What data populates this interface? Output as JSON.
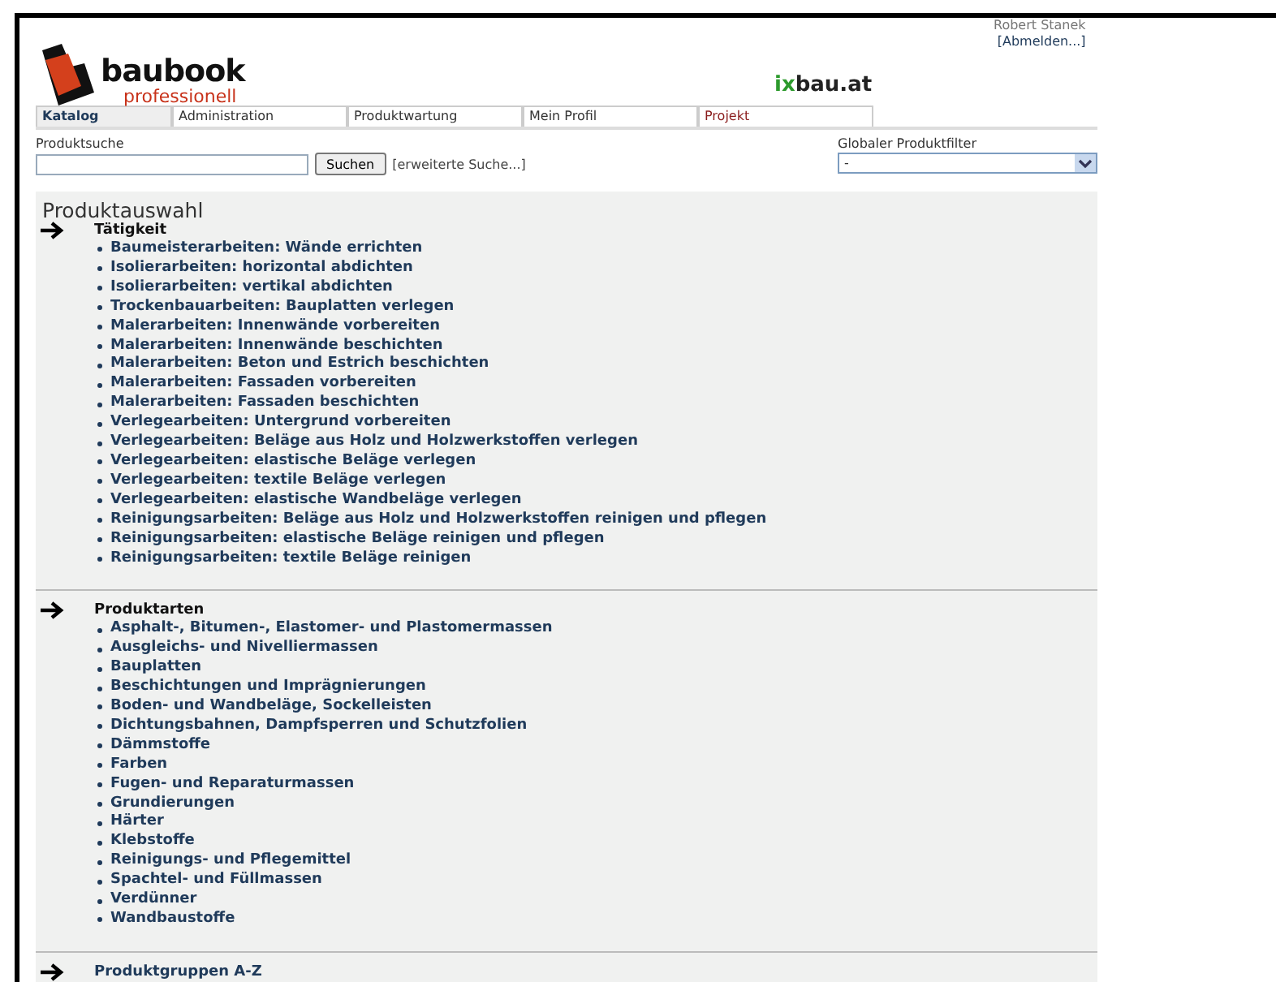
{
  "user": {
    "name": "Robert Stanek",
    "logout": "[Abmelden...]"
  },
  "brand": {
    "name": "baubook",
    "subtitle": "professionell"
  },
  "partner": {
    "prefix": "ix",
    "rest": "bau.at"
  },
  "tabs": [
    {
      "label": "Katalog",
      "selected": true,
      "color": "#1f3a5a"
    },
    {
      "label": "Administration",
      "selected": false,
      "color": "#333333"
    },
    {
      "label": "Produktwartung",
      "selected": false,
      "color": "#333333"
    },
    {
      "label": "Mein Profil",
      "selected": false,
      "color": "#333333"
    },
    {
      "label": "Projekt",
      "selected": false,
      "color": "#8b1e1e"
    }
  ],
  "search": {
    "label": "Produktsuche",
    "button": "Suchen",
    "advanced": "[erweiterte Suche...]"
  },
  "filter": {
    "label": "Globaler Produktfilter",
    "value": "-"
  },
  "panel": {
    "title": "Produktauswahl",
    "sections": [
      {
        "heading": "Tätigkeit",
        "expanded": true,
        "items": [
          "Baumeisterarbeiten: Wände errichten",
          "Isolierarbeiten: horizontal abdichten",
          "Isolierarbeiten: vertikal abdichten",
          "Trockenbauarbeiten: Bauplatten verlegen",
          "Malerarbeiten: Innenwände vorbereiten",
          "Malerarbeiten: Innenwände beschichten",
          "Malerarbeiten: Beton und Estrich beschichten",
          "Malerarbeiten: Fassaden vorbereiten",
          "Malerarbeiten: Fassaden beschichten",
          "Verlegearbeiten: Untergrund vorbereiten",
          "Verlegearbeiten: Beläge aus Holz und Holzwerkstoffen verlegen",
          "Verlegearbeiten: elastische Beläge verlegen",
          "Verlegearbeiten: textile Beläge verlegen",
          "Verlegearbeiten: elastische Wandbeläge verlegen",
          "Reinigungsarbeiten: Beläge aus Holz und Holzwerkstoffen reinigen und pflegen",
          "Reinigungsarbeiten: elastische Beläge reinigen und pflegen",
          "Reinigungsarbeiten: textile Beläge reinigen"
        ]
      },
      {
        "heading": "Produktarten",
        "expanded": true,
        "items": [
          "Asphalt-, Bitumen-, Elastomer- und Plastomermassen",
          "Ausgleichs- und Nivelliermassen",
          "Bauplatten",
          "Beschichtungen und Imprägnierungen",
          "Boden- und Wandbeläge, Sockelleisten",
          "Dichtungsbahnen, Dampfsperren und Schutzfolien",
          "Dämmstoffe",
          "Farben",
          "Fugen- und Reparaturmassen",
          "Grundierungen",
          "Härter",
          "Klebstoffe",
          "Reinigungs- und Pflegemittel",
          "Spachtel- und Füllmassen",
          "Verdünner",
          "Wandbaustoffe"
        ]
      },
      {
        "heading": "Produktgruppen A-Z",
        "expanded": false
      }
    ]
  }
}
